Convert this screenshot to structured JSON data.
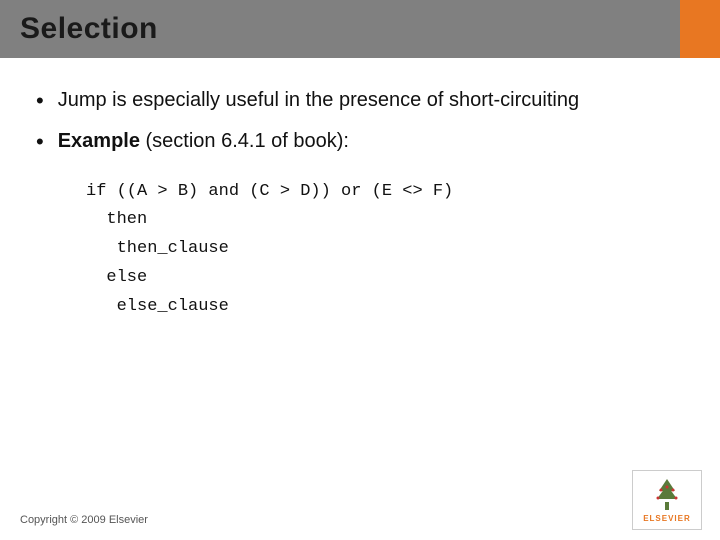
{
  "header": {
    "title": "Selection",
    "accent_color": "#e87722",
    "bg_color": "#808080"
  },
  "bullets": [
    {
      "id": "bullet1",
      "text": "Jump is especially useful in the presence of short-circuiting"
    },
    {
      "id": "bullet2",
      "prefix": "Example",
      "text": " (section 6.4.1 of book):"
    }
  ],
  "code": {
    "lines": [
      "if ((A > B) and (C > D)) or (E <> F)",
      "  then",
      "   then_clause",
      "  else",
      "   else_clause"
    ]
  },
  "footer": {
    "copyright": "Copyright © 2009 Elsevier",
    "logo_label": "ELSEVIER"
  }
}
